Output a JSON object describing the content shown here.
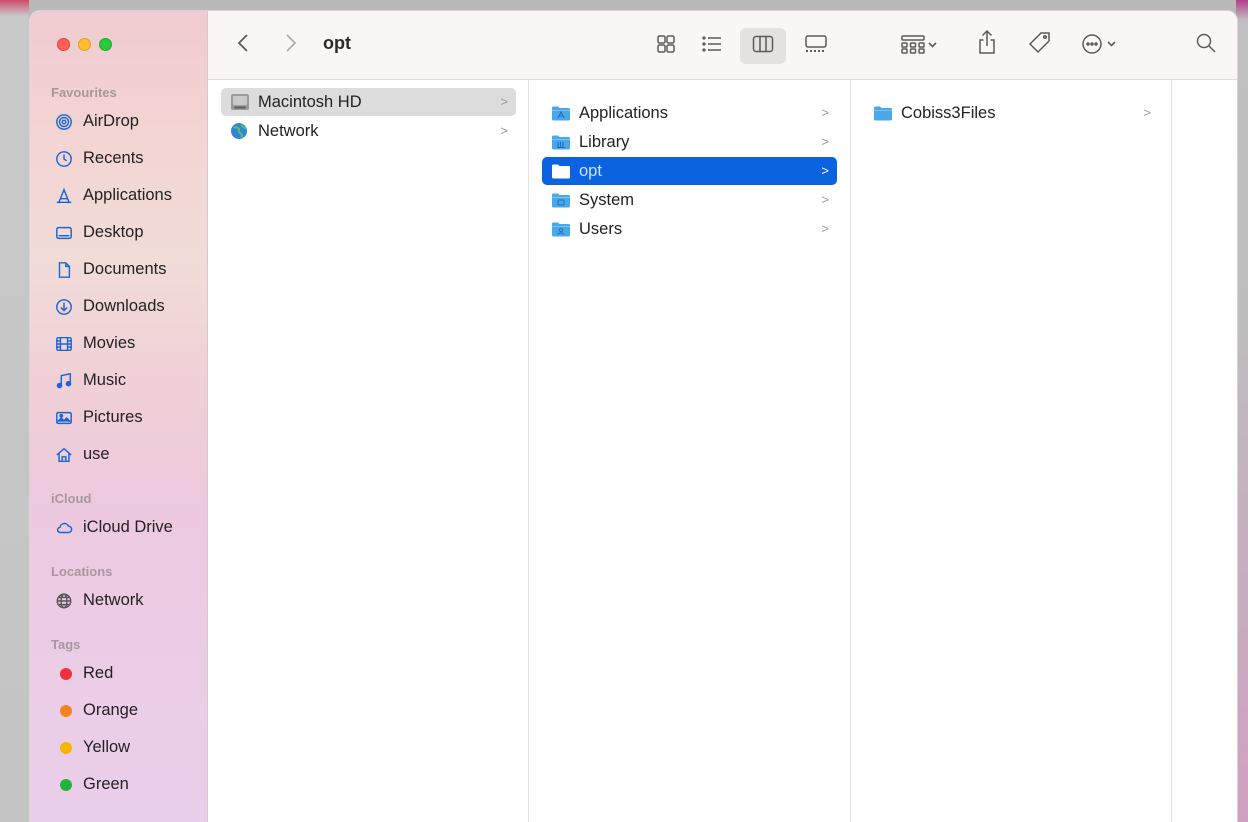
{
  "window": {
    "title": "opt"
  },
  "toolbar": {
    "back_icon": "chevron-left-icon",
    "forward_icon": "chevron-right-icon",
    "view_icons": [
      "icon-view-icon",
      "list-view-icon",
      "column-view-icon",
      "gallery-view-icon"
    ],
    "selected_view": "column-view-icon",
    "group_icon": "group-icon",
    "share_icon": "share-icon",
    "tag_icon": "tag-icon",
    "more_icon": "more-icon",
    "search_icon": "search-icon"
  },
  "sidebar": {
    "favourites_heading": "Favourites",
    "favourites": [
      {
        "label": "AirDrop",
        "icon": "airdrop-icon"
      },
      {
        "label": "Recents",
        "icon": "clock-icon"
      },
      {
        "label": "Applications",
        "icon": "applications-icon"
      },
      {
        "label": "Desktop",
        "icon": "desktop-icon"
      },
      {
        "label": "Documents",
        "icon": "document-icon"
      },
      {
        "label": "Downloads",
        "icon": "download-icon"
      },
      {
        "label": "Movies",
        "icon": "film-icon"
      },
      {
        "label": "Music",
        "icon": "music-icon"
      },
      {
        "label": "Pictures",
        "icon": "photo-icon"
      },
      {
        "label": "use",
        "icon": "home-icon"
      }
    ],
    "icloud_heading": "iCloud",
    "icloud": [
      {
        "label": "iCloud Drive",
        "icon": "cloud-icon"
      }
    ],
    "locations_heading": "Locations",
    "locations": [
      {
        "label": "Network",
        "icon": "globe-icon"
      }
    ],
    "tags_heading": "Tags",
    "tags": [
      {
        "label": "Red",
        "color": "#f0303a"
      },
      {
        "label": "Orange",
        "color": "#f5841f"
      },
      {
        "label": "Yellow",
        "color": "#f7b500"
      },
      {
        "label": "Green",
        "color": "#22b33f"
      }
    ]
  },
  "columns": {
    "col1": [
      {
        "label": "Macintosh HD",
        "icon": "hard-drive-icon",
        "selected": "gray"
      },
      {
        "label": "Network",
        "icon": "network-globe-icon"
      }
    ],
    "col2": [
      {
        "label": "Applications",
        "icon": "applications-folder-icon"
      },
      {
        "label": "Library",
        "icon": "library-folder-icon"
      },
      {
        "label": "opt",
        "icon": "folder-icon",
        "selected": "blue"
      },
      {
        "label": "System",
        "icon": "system-folder-icon"
      },
      {
        "label": "Users",
        "icon": "users-folder-icon"
      }
    ],
    "col3": [
      {
        "label": "Cobiss3Files",
        "icon": "folder-icon"
      }
    ]
  },
  "colors": {
    "accent": "#0c63e0",
    "folder": "#4aa8ea"
  }
}
